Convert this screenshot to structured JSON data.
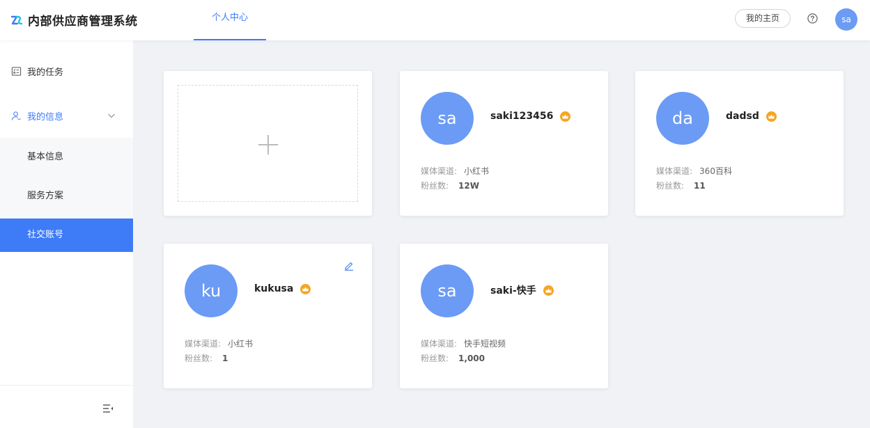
{
  "header": {
    "app_title": "内部供应商管理系统",
    "nav_tab": "个人中心",
    "home_button": "我的主页",
    "user_avatar": "sa"
  },
  "sidebar": {
    "tasks_label": "我的任务",
    "info_label": "我的信息",
    "sub_items": [
      "基本信息",
      "服务方案",
      "社交账号"
    ]
  },
  "cards": [
    {
      "avatar": "sa",
      "name": "saki123456",
      "channel_label": "媒体渠道:",
      "channel": "小红书",
      "fans_label": "粉丝数:",
      "fans": "12W"
    },
    {
      "avatar": "da",
      "name": "dadsd",
      "channel_label": "媒体渠道:",
      "channel": "360百科",
      "fans_label": "粉丝数:",
      "fans": "11"
    },
    {
      "avatar": "ku",
      "name": "kukusa",
      "channel_label": "媒体渠道:",
      "channel": "小红书",
      "fans_label": "粉丝数:",
      "fans": "1"
    },
    {
      "avatar": "sa",
      "name": "saki-快手",
      "channel_label": "媒体渠道:",
      "channel": "快手短视频",
      "fans_label": "粉丝数:",
      "fans": "1,000"
    }
  ],
  "colors": {
    "accent": "#3d7bf7",
    "avatar": "#6b9bf5",
    "badge": "#f5a623"
  }
}
